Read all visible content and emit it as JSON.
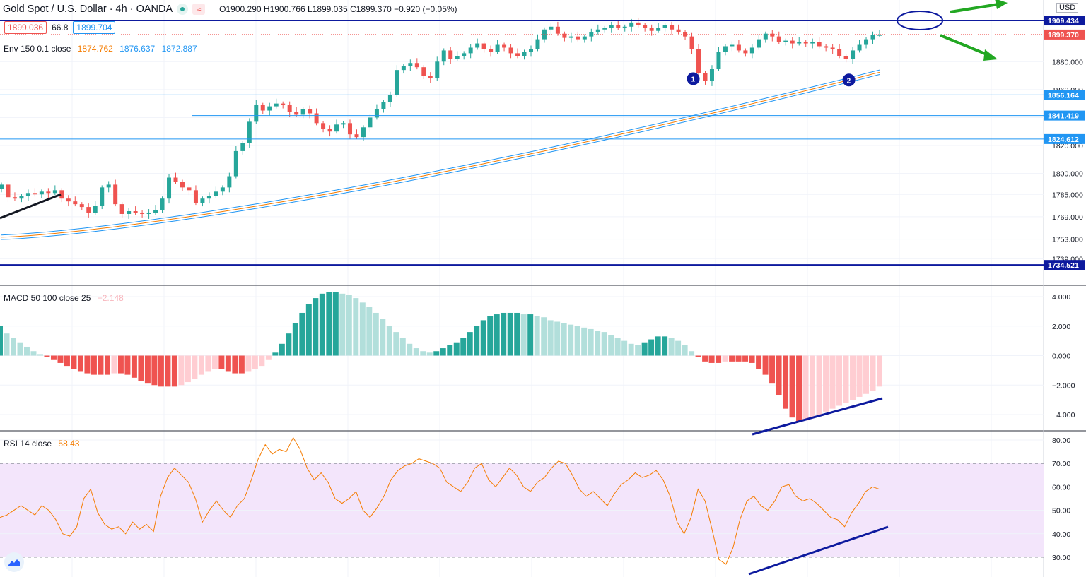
{
  "header": {
    "title": "Gold Spot / U.S. Dollar · 4h · OANDA",
    "open_label": "O",
    "open": "1900.290",
    "high_label": "H",
    "high": "1900.766",
    "low_label": "L",
    "low": "1899.035",
    "close_label": "C",
    "close": "1899.370",
    "change": "−0.920 (−0.05%)"
  },
  "quote": {
    "bid": "1899.036",
    "spread": "66.8",
    "ask": "1899.704"
  },
  "currency": "USD",
  "colors": {
    "up": "#26a69a",
    "down": "#ef5350",
    "hline": "#2196f3",
    "dark_line": "#0d1a9e",
    "arrow": "#22a722",
    "rsi": "#f57c00",
    "rsi_band": "#f3e5fb"
  },
  "chart_data": [
    {
      "type": "candlestick",
      "title": "Gold Spot / U.S. Dollar · 4h · OANDA",
      "ylim": [
        1725,
        1915
      ],
      "y_ticks": [
        1739,
        1753,
        1769,
        1785,
        1800,
        1820,
        1840,
        1860,
        1880
      ],
      "y_tick_labels": [
        "1739.000",
        "1753.000",
        "1769.000",
        "1785.000",
        "1800.000",
        "1820.000",
        "1840.000",
        "1860.000",
        "1880.000"
      ],
      "candle_closes": [
        1792,
        1783,
        1782,
        1784,
        1786,
        1785,
        1787,
        1786,
        1788,
        1782,
        1780,
        1778,
        1776,
        1772,
        1777,
        1790,
        1792,
        1778,
        1771,
        1773,
        1772,
        1771,
        1772,
        1774,
        1782,
        1797,
        1794,
        1790,
        1788,
        1779,
        1782,
        1784,
        1787,
        1790,
        1798,
        1816,
        1822,
        1837,
        1849,
        1845,
        1848,
        1850,
        1849,
        1844,
        1842,
        1846,
        1843,
        1836,
        1832,
        1830,
        1835,
        1836,
        1828,
        1826,
        1833,
        1840,
        1846,
        1851,
        1856,
        1874,
        1877,
        1879,
        1876,
        1870,
        1868,
        1880,
        1888,
        1882,
        1884,
        1886,
        1890,
        1893,
        1889,
        1887,
        1892,
        1890,
        1886,
        1884,
        1887,
        1889,
        1896,
        1903,
        1905,
        1900,
        1897,
        1898,
        1896,
        1898,
        1901,
        1903,
        1904,
        1906,
        1904,
        1905,
        1908,
        1906,
        1904,
        1902,
        1904,
        1906,
        1903,
        1901,
        1898,
        1889,
        1872,
        1866,
        1875,
        1887,
        1891,
        1892,
        1888,
        1886,
        1890,
        1896,
        1900,
        1898,
        1894,
        1895,
        1893,
        1894,
        1893,
        1894,
        1891,
        1890,
        1889,
        1884,
        1882,
        1888,
        1892,
        1896,
        1899,
        1899
      ],
      "envelope": {
        "label": "Env 150 0.1 close",
        "values": [
          "1874.762",
          "1876.637",
          "1872.887"
        ],
        "colors": [
          "#f57c00",
          "#2196f3",
          "#2196f3"
        ]
      },
      "horizontal_levels": [
        {
          "value": 1909.434,
          "label": "1909.434",
          "color": "#0d1a9e"
        },
        {
          "value": 1899.37,
          "label": "1899.370",
          "color": "#ef5350"
        },
        {
          "value": 1856.164,
          "label": "1856.164",
          "color": "#2196f3"
        },
        {
          "value": 1841.419,
          "label": "1841.419",
          "color": "#2196f3"
        },
        {
          "value": 1824.612,
          "label": "1824.612",
          "color": "#2196f3"
        },
        {
          "value": 1734.521,
          "label": "1734.521",
          "color": "#0d1a9e"
        }
      ],
      "markers": [
        "1",
        "2"
      ]
    },
    {
      "type": "bar",
      "title": "MACD 50 100 close 25",
      "last_value": "−2.148",
      "ylim": [
        -4.6,
        4.6
      ],
      "y_ticks": [
        4,
        2,
        0,
        -2,
        -4
      ],
      "y_tick_labels": [
        "4.000",
        "2.000",
        "0.000",
        "−2.000",
        "−4.000"
      ],
      "values": [
        2.0,
        1.5,
        1.2,
        0.9,
        0.6,
        0.3,
        0.1,
        -0.1,
        -0.3,
        -0.5,
        -0.7,
        -0.9,
        -1.1,
        -1.2,
        -1.3,
        -1.3,
        -1.3,
        -1.2,
        -1.2,
        -1.3,
        -1.5,
        -1.7,
        -1.9,
        -2.0,
        -2.1,
        -2.1,
        -2.1,
        -2.0,
        -1.8,
        -1.6,
        -1.3,
        -1.1,
        -0.9,
        -0.9,
        -1.1,
        -1.2,
        -1.2,
        -1.1,
        -0.9,
        -0.7,
        -0.3,
        0.2,
        0.8,
        1.5,
        2.2,
        2.9,
        3.5,
        3.9,
        4.2,
        4.3,
        4.3,
        4.2,
        4.1,
        3.9,
        3.6,
        3.3,
        2.9,
        2.5,
        2.0,
        1.6,
        1.2,
        0.8,
        0.5,
        0.3,
        0.2,
        0.3,
        0.5,
        0.7,
        0.9,
        1.2,
        1.6,
        2.0,
        2.4,
        2.7,
        2.8,
        2.9,
        2.9,
        2.9,
        2.8,
        2.8,
        2.7,
        2.6,
        2.4,
        2.3,
        2.2,
        2.1,
        2.0,
        1.9,
        1.8,
        1.7,
        1.6,
        1.4,
        1.2,
        1.0,
        0.8,
        0.7,
        0.9,
        1.1,
        1.3,
        1.3,
        1.2,
        1.0,
        0.7,
        0.3,
        -0.1,
        -0.4,
        -0.5,
        -0.5,
        -0.4,
        -0.4,
        -0.4,
        -0.4,
        -0.5,
        -0.9,
        -1.3,
        -1.9,
        -2.7,
        -3.6,
        -4.2,
        -4.5,
        -4.4,
        -4.2,
        -4.0,
        -3.8,
        -3.6,
        -3.4,
        -3.2,
        -3.0,
        -2.8,
        -2.6,
        -2.4,
        -2.1
      ]
    },
    {
      "type": "line",
      "title": "RSI 14 close",
      "last_value": "58.43",
      "ylim": [
        24,
        84
      ],
      "band": [
        30,
        70
      ],
      "y_ticks": [
        80,
        70,
        60,
        50,
        40,
        30
      ],
      "y_tick_labels": [
        "80.00",
        "70.00",
        "60.00",
        "50.00",
        "40.00",
        "30.00"
      ],
      "values": [
        47,
        48,
        50,
        52,
        50,
        48,
        52,
        50,
        46,
        40,
        39,
        43,
        55,
        59,
        49,
        44,
        42,
        43,
        40,
        45,
        42,
        44,
        41,
        56,
        64,
        68,
        65,
        62,
        55,
        45,
        50,
        54,
        50,
        47,
        52,
        55,
        63,
        72,
        78,
        74,
        76,
        75,
        81,
        76,
        68,
        63,
        66,
        62,
        55,
        53,
        55,
        58,
        50,
        47,
        51,
        56,
        63,
        67,
        69,
        70,
        72,
        71,
        70,
        68,
        62,
        60,
        58,
        62,
        68,
        70,
        63,
        60,
        64,
        68,
        65,
        60,
        58,
        62,
        64,
        68,
        71,
        70,
        65,
        59,
        56,
        58,
        55,
        52,
        57,
        61,
        63,
        66,
        64,
        65,
        67,
        63,
        56,
        45,
        40,
        47,
        59,
        54,
        42,
        29,
        27,
        34,
        46,
        54,
        56,
        52,
        50,
        54,
        60,
        61,
        56,
        54,
        55,
        53,
        50,
        47,
        46,
        43,
        49,
        53,
        58,
        60,
        59
      ]
    }
  ]
}
